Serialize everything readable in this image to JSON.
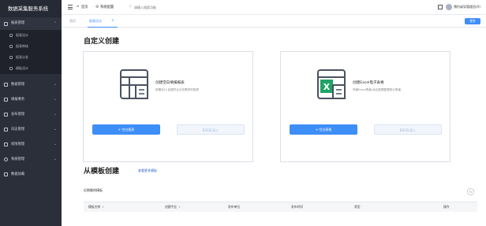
{
  "app": {
    "title": "数据采集服务系统"
  },
  "sidebar": {
    "groups": [
      {
        "label": "报表管理",
        "expanded": true,
        "children": [
          "报表设计",
          "报表审核",
          "报表分发",
          "模板设计"
        ]
      },
      {
        "label": "数据管理",
        "expanded": false
      },
      {
        "label": "填报事务",
        "expanded": false
      },
      {
        "label": "发布管理",
        "expanded": false
      },
      {
        "label": "日志管理",
        "expanded": false
      },
      {
        "label": "权限管理",
        "expanded": false
      },
      {
        "label": "系统管理",
        "expanded": false
      },
      {
        "label": "数据加载",
        "expanded": false
      }
    ]
  },
  "topbar": {
    "breadcrumb_home": "首页",
    "breadcrumb_current": "系统配置",
    "search_placeholder": "请输入搜索功能",
    "user_name": "预约或导管理员(A)"
  },
  "tabs": [
    {
      "label": "首页",
      "active": false
    },
    {
      "label": "报表设计",
      "active": true
    }
  ],
  "toolbar": {
    "more_label": "更多"
  },
  "main": {
    "custom_title": "自定义创建",
    "template_title": "从模板创建",
    "template_more_link": "查看更多模板",
    "recent_label": "近期最热模板"
  },
  "cards": [
    {
      "icon": "table-design-icon",
      "title": "创建空白填报报表",
      "desc": "按需设计,创建符合业务需求的报表",
      "primary_label": "+ 空白报表",
      "secondary_label": "EXCEL导入"
    },
    {
      "icon": "excel-icon",
      "title": "创建Excel电子表格",
      "desc": "快速Excel表格,适合数据整理统计表格",
      "primary_label": "+ 空白表格",
      "secondary_label": "EXCEL导入"
    }
  ],
  "table": {
    "columns": [
      "模板名称",
      "创建专业",
      "发布单位",
      "发布时间",
      "类型",
      "操作"
    ]
  },
  "colors": {
    "accent": "#3e8ef7",
    "sidebar_bg": "#2b2f3a",
    "excel_green": "#21a366"
  }
}
